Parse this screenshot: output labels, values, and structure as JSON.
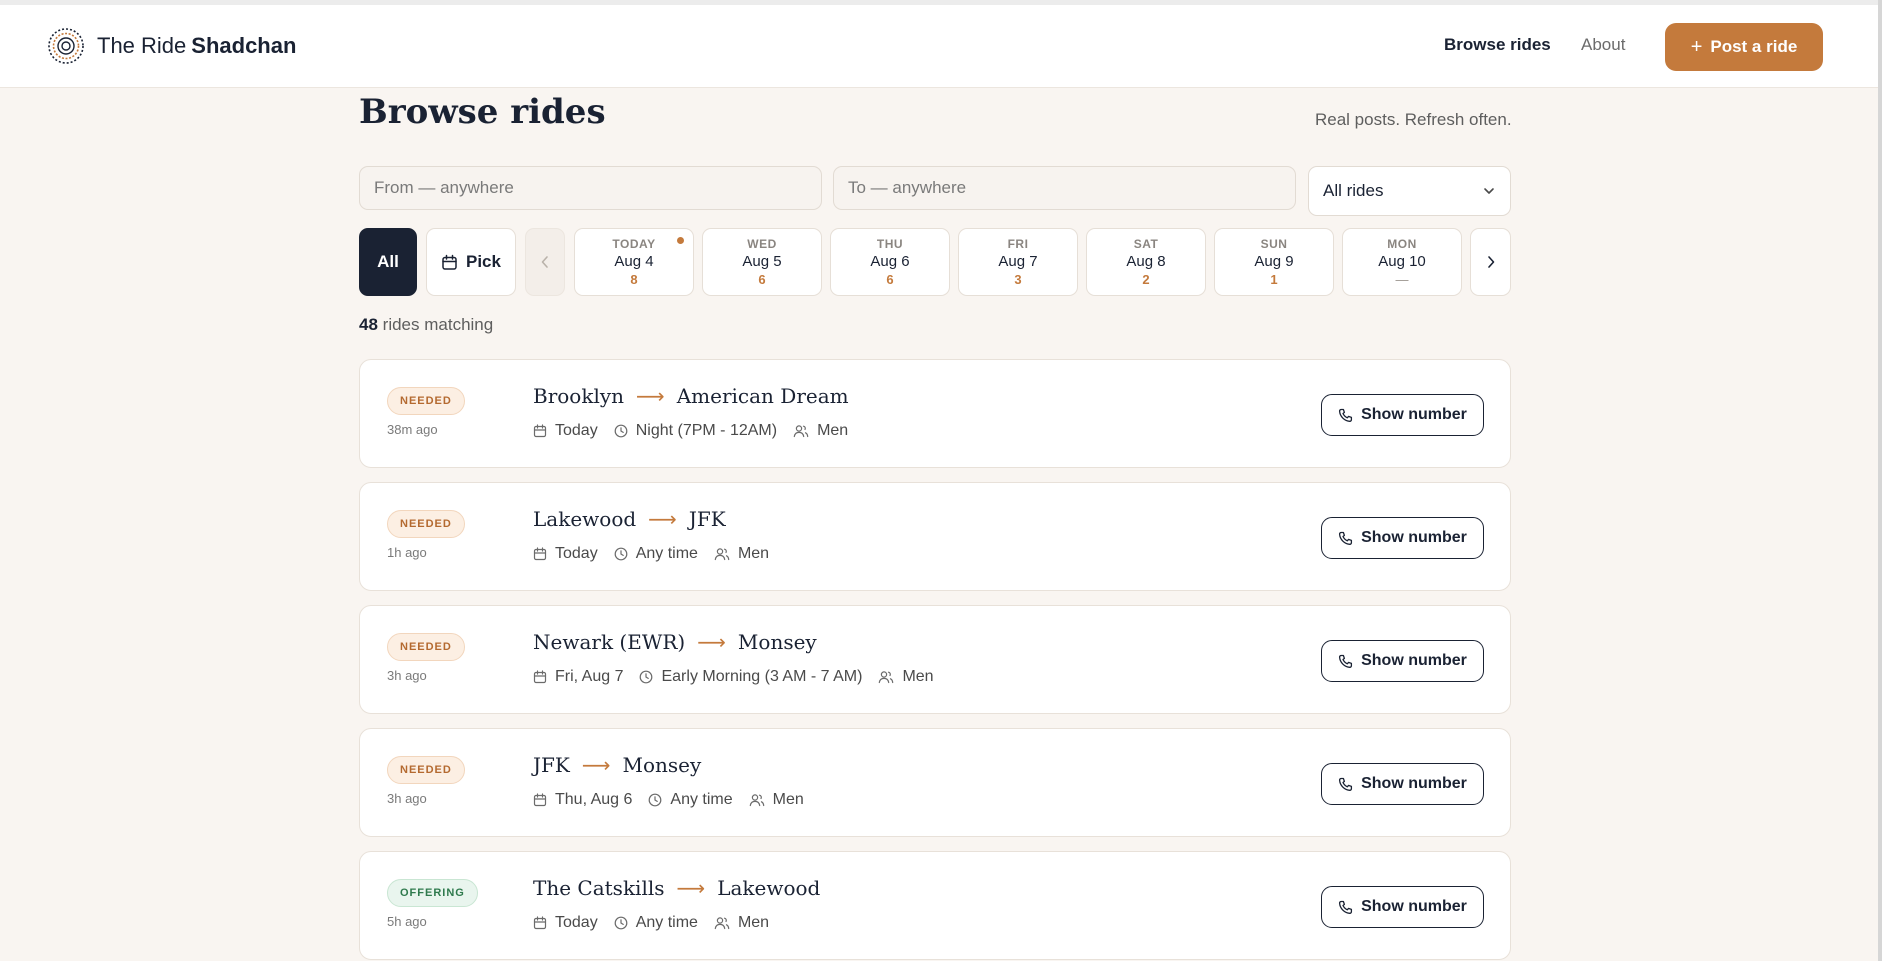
{
  "app": {
    "name_part1": "The Ride",
    "name_part2": "Shadchan"
  },
  "nav": {
    "browse": "Browse rides",
    "about": "About",
    "post_plus": "+",
    "post": "Post a ride"
  },
  "page": {
    "title": "Browse rides",
    "tagline": "Real posts. Refresh often."
  },
  "filters": {
    "from_placeholder": "From — anywhere",
    "to_placeholder": "To — anywhere",
    "select_value": "All rides"
  },
  "dates": {
    "all": "All",
    "pick": "Pick",
    "days": [
      {
        "dow": "TODAY",
        "date": "Aug 4",
        "count": "8"
      },
      {
        "dow": "WED",
        "date": "Aug 5",
        "count": "6"
      },
      {
        "dow": "THU",
        "date": "Aug 6",
        "count": "6"
      },
      {
        "dow": "FRI",
        "date": "Aug 7",
        "count": "3"
      },
      {
        "dow": "SAT",
        "date": "Aug 8",
        "count": "2"
      },
      {
        "dow": "SUN",
        "date": "Aug 9",
        "count": "1"
      },
      {
        "dow": "MON",
        "date": "Aug 10",
        "count": "—"
      }
    ]
  },
  "results": {
    "count": "48",
    "label": "rides matching"
  },
  "colors": {
    "accent": "#c47a3c",
    "dark": "#1a2233",
    "background": "#f9f5f1"
  },
  "rides": [
    {
      "badge": "NEEDED",
      "ago": "38m ago",
      "from": "Brooklyn",
      "to": "American Dream",
      "day": "Today",
      "time": "Night (7PM - 12AM)",
      "who": "Men",
      "button": "Show number"
    },
    {
      "badge": "NEEDED",
      "ago": "1h ago",
      "from": "Lakewood",
      "to": "JFK",
      "day": "Today",
      "time": "Any time",
      "who": "Men",
      "button": "Show number"
    },
    {
      "badge": "NEEDED",
      "ago": "3h ago",
      "from": "Newark (EWR)",
      "to": "Monsey",
      "day": "Fri, Aug 7",
      "time": "Early Morning (3 AM - 7 AM)",
      "who": "Men",
      "button": "Show number"
    },
    {
      "badge": "NEEDED",
      "ago": "3h ago",
      "from": "JFK",
      "to": "Monsey",
      "day": "Thu, Aug 6",
      "time": "Any time",
      "who": "Men",
      "button": "Show number"
    },
    {
      "badge": "OFFERING",
      "ago": "5h ago",
      "from": "The Catskills",
      "to": "Lakewood",
      "day": "Today",
      "time": "Any time",
      "who": "Men",
      "button": "Show number"
    }
  ]
}
